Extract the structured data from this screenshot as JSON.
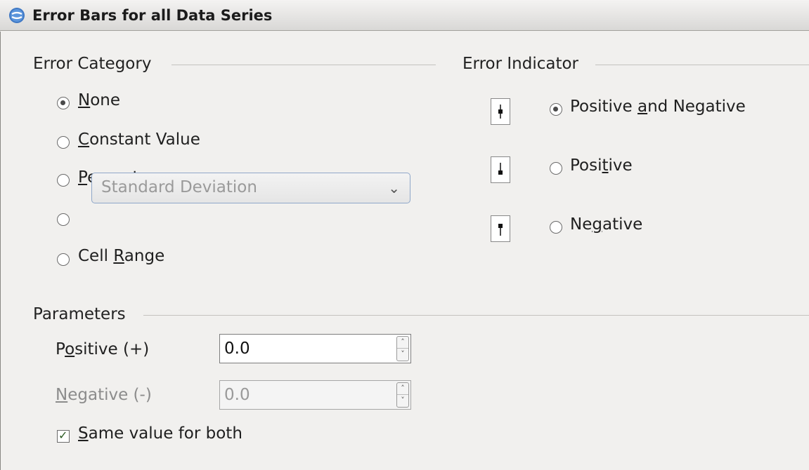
{
  "dialog": {
    "title": "Error Bars for all Data Series",
    "app_icon": "libreoffice-icon"
  },
  "error_category": {
    "header": "Error Category",
    "options": [
      {
        "pre": "",
        "u": "N",
        "post": "one",
        "selected": true
      },
      {
        "pre": "",
        "u": "C",
        "post": "onstant Value",
        "selected": false
      },
      {
        "pre": "",
        "u": "P",
        "post": "ercentage",
        "selected": false
      },
      {
        "pre": "",
        "u": "",
        "post": "",
        "selected": false
      },
      {
        "pre": "Cell ",
        "u": "R",
        "post": "ange",
        "selected": false
      }
    ],
    "function_select": {
      "value": "Standard Deviation",
      "disabled": true,
      "arrow_icon": "chevron-down-icon"
    }
  },
  "error_indicator": {
    "header": "Error Indicator",
    "options": [
      {
        "pre": "Positive ",
        "u": "a",
        "post": "nd Negative",
        "selected": true,
        "icon": "error-bar-both-icon"
      },
      {
        "pre": "Posi",
        "u": "t",
        "post": "ive",
        "selected": false,
        "icon": "error-bar-positive-icon"
      },
      {
        "pre": "Ne",
        "u": "g",
        "post": "ative",
        "selected": false,
        "icon": "error-bar-negative-icon"
      }
    ]
  },
  "parameters": {
    "header": "Parameters",
    "positive": {
      "pre": "P",
      "u": "o",
      "post": "sitive (+)",
      "value": "0.0",
      "disabled": false
    },
    "negative": {
      "pre": "",
      "u": "N",
      "post": "egative (-)",
      "value": "0.0",
      "disabled": true
    },
    "same_value": {
      "pre": "",
      "u": "S",
      "post": "ame value for both",
      "checked": true
    }
  }
}
